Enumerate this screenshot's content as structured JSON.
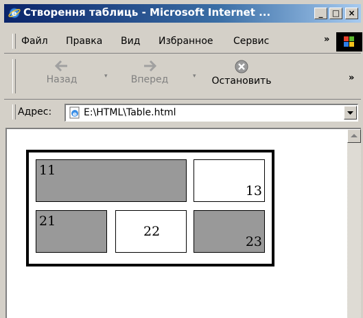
{
  "window": {
    "title": "Створення таблиць - Microsoft Internet ...",
    "buttons": {
      "minimize": "_",
      "maximize": "□",
      "close": "×"
    }
  },
  "menu": {
    "items": [
      {
        "label": "Файл",
        "name": "file"
      },
      {
        "label": "Правка",
        "name": "edit"
      },
      {
        "label": "Вид",
        "name": "view"
      },
      {
        "label": "Избранное",
        "name": "favorites"
      },
      {
        "label": "Сервис",
        "name": "tools"
      }
    ],
    "chevron": "»"
  },
  "toolbar": {
    "back_label": "Назад",
    "forward_label": "Вперед",
    "stop_label": "Остановить",
    "chevron": "»"
  },
  "address": {
    "label": "Адрес:",
    "value": "E:\\HTML\\Table.html"
  },
  "page": {
    "cells": {
      "c11": "11",
      "c13": "13",
      "c21": "21",
      "c22": "22",
      "c23": "23"
    }
  },
  "colors": {
    "title_gradient_start": "#0a246a",
    "title_gradient_end": "#a6caf0",
    "chrome": "#d4d0c8",
    "cell_gray": "#999999"
  }
}
